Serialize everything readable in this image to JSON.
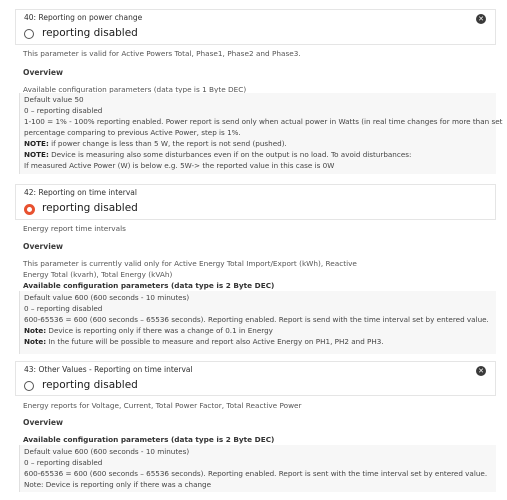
{
  "sections": [
    {
      "title": "40: Reporting on power change",
      "radio_label": "reporting disabled",
      "selected": false,
      "desc": "This parameter is valid for Active Powers Total, Phase1, Phase2 and Phase3.",
      "overview": "Overview",
      "avail": "Available configuration parameters (data type is 1 Byte DEC)",
      "lines": [
        {
          "text": "Default value 50"
        },
        {
          "text": "0 – reporting disabled"
        },
        {
          "text": "1-100 = 1% - 100% reporting enabled. Power report is send only when actual power in Watts (in real time changes for more than set"
        },
        {
          "text": "percentage comparing to previous Active Power, step is 1%."
        },
        {
          "label": "NOTE:",
          "text": " if power change is less than 5 W, the report is not send (pushed)."
        },
        {
          "label": "NOTE:",
          "text": " Device is measuring also some disturbances even if on the output is no load. To avoid disturbances:"
        },
        {
          "text": "If measured Active Power (W) is below e.g. 5W-> the reported value in this case is 0W"
        }
      ]
    },
    {
      "title": "42: Reporting on time interval",
      "radio_label": "reporting disabled",
      "selected": true,
      "desc": "Energy report time intervals",
      "overview": "Overview",
      "intro": [
        "This parameter is currently valid only for Active Energy Total Import/Export (kWh), Reactive",
        "Energy Total (kvarh), Total Energy (kVAh)"
      ],
      "avail": "Available configuration parameters (data type is 2 Byte DEC)",
      "lines": [
        {
          "text": "Default value 600 (600 seconds - 10 minutes)"
        },
        {
          "text": "0 – reporting disabled"
        },
        {
          "text": "600-65536 = 600 (600 seconds – 65536 seconds). Reporting enabled. Report is send with the time interval set by entered value."
        },
        {
          "label": "Note:",
          "text": " Device is reporting only if there was a change of 0.1 in Energy"
        },
        {
          "label": "Note:",
          "text": " In the future will be possible to measure and report also Active Energy on PH1, PH2 and PH3."
        }
      ]
    },
    {
      "title": "43: Other Values - Reporting on time interval",
      "radio_label": "reporting disabled",
      "selected": false,
      "desc": "Energy reports for Voltage, Current, Total Power Factor, Total Reactive Power",
      "overview": "Overview",
      "avail": "Available configuration parameters (data type is 2 Byte DEC)",
      "lines": [
        {
          "text": "Default value 600 (600 seconds - 10 minutes)"
        },
        {
          "text": "0 – reporting disabled"
        },
        {
          "text": "600-65536 = 600 (600 seconds – 65536 seconds). Reporting enabled. Report is sent with the time interval set by entered value."
        },
        {
          "text": "Note: Device is reporting only if there was a change"
        }
      ]
    }
  ],
  "colors": {
    "accent": "#e8512f",
    "close": "#3a3a3a"
  },
  "icons": {
    "close": "close-icon",
    "radio": "radio-icon"
  }
}
